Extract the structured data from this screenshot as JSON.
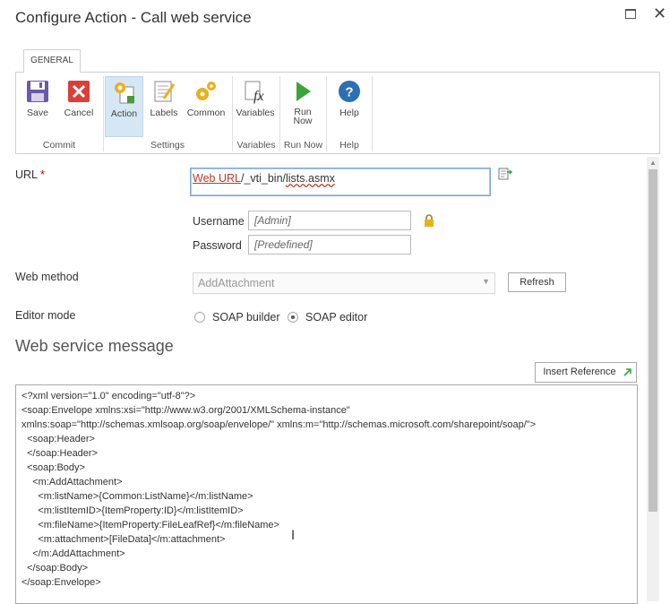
{
  "dialog": {
    "title": "Configure Action - Call web service"
  },
  "ribbon": {
    "tab": "GENERAL",
    "buttons": {
      "save": "Save",
      "cancel": "Cancel",
      "action": "Action",
      "labels": "Labels",
      "common": "Common",
      "variables": "Variables",
      "run_now_line1": "Run",
      "run_now_line2": "Now",
      "help": "Help"
    },
    "groups": {
      "commit": "Commit",
      "settings": "Settings",
      "variables": "Variables",
      "run_now": "Run Now",
      "help": "Help"
    }
  },
  "form": {
    "url_label": "URL",
    "required_marker": "*",
    "url_token": "Web URL",
    "url_sep": "/_vti_bin/",
    "url_file": "lists.asmx",
    "username_label": "Username",
    "username_value": "[Admin]",
    "password_label": "Password",
    "password_value": "[Predefined]",
    "web_method_label": "Web method",
    "web_method_value": "AddAttachment",
    "refresh_button": "Refresh",
    "editor_mode_label": "Editor mode",
    "soap_builder": "SOAP builder",
    "soap_editor": "SOAP editor",
    "editor_mode_selected": "SOAP editor"
  },
  "message": {
    "title": "Web service message",
    "insert_reference": "Insert Reference",
    "lines": [
      "<?xml version=\"1.0\" encoding=\"utf-8\"?>",
      "<soap:Envelope xmlns:xsi=\"http://www.w3.org/2001/XMLSchema-instance\"",
      "xmlns:soap=\"http://schemas.xmlsoap.org/soap/envelope/\" xmlns:m=\"http://schemas.microsoft.com/sharepoint/soap/\">",
      "  <soap:Header>",
      "  </soap:Header>",
      "  <soap:Body>",
      "    <m:AddAttachment>",
      "      <m:listName>{Common:ListName}</m:listName>",
      "      <m:listItemID>{ItemProperty:ID}</m:listItemID>",
      "      <m:fileName>{ItemProperty:FileLeafRef}</m:fileName>",
      "      <m:attachment>[FileData]</m:attachment>",
      "    </m:AddAttachment>",
      "  </soap:Body>",
      "</soap:Envelope>"
    ]
  }
}
